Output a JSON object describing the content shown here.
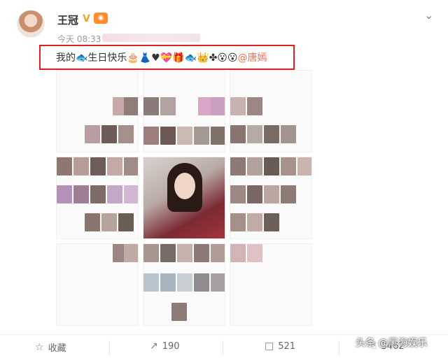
{
  "post": {
    "author": "王冠",
    "verified_mark": "V",
    "vip_badge": "会员",
    "time": "今天 08:33",
    "text_before": "我的🐟生日快乐🎂👗♥💝🎁🐟👑✤😮😮",
    "mention": "@唐嫣"
  },
  "actions": {
    "favorite_label": "收藏",
    "repost_count": "190",
    "comment_count": "521",
    "like_count": "3462"
  },
  "watermark": "头条 @黑海娱乐",
  "colors": {
    "mention": "#eb7350",
    "highlight_border": "#e02020",
    "vip": "#ff8d2a"
  }
}
